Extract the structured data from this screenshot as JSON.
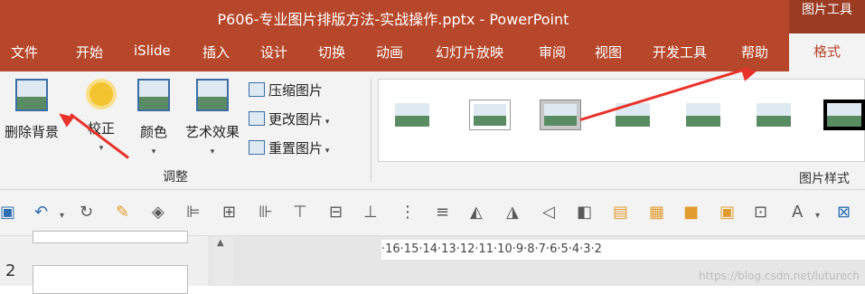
{
  "window": {
    "title": "P606-专业图片排版方法-实战操作.pptx  -  PowerPoint",
    "context_tab_title": "图片工具"
  },
  "tabs": [
    "文件",
    "开始",
    "iSlide",
    "插入",
    "设计",
    "切换",
    "动画",
    "幻灯片放映",
    "审阅",
    "视图",
    "开发工具",
    "帮助"
  ],
  "active_tab": "格式",
  "ribbon": {
    "adjust": {
      "remove_bg": "删除背景",
      "corrections": "校正",
      "color": "颜色",
      "artistic": "艺术效果",
      "compress": "压缩图片",
      "change": "更改图片",
      "reset": "重置图片",
      "group_label": "调整"
    },
    "styles": {
      "group_label": "图片样式"
    }
  },
  "toolbar_icons": [
    "save-icon",
    "undo-icon",
    "redo-icon",
    "format-painter-icon",
    "eraser-icon",
    "align-left-icon",
    "align-center-icon",
    "align-right-icon",
    "align-top-icon",
    "align-middle-icon",
    "align-bottom-icon",
    "distribute-h-icon",
    "distribute-v-icon",
    "rotate-icon",
    "flip-icon",
    "triangle-left-icon",
    "triangle-right-icon",
    "group-icon",
    "ungroup-icon",
    "bring-front-icon",
    "send-back-icon",
    "select-icon",
    "text-icon",
    "fit-icon"
  ],
  "ruler_text": "·16·15·14·13·12·11·10·9·8·7·6·5·4·3·2",
  "slide_number": "2",
  "watermark": "https://blog.csdn.net/luturech",
  "colors": {
    "accent": "#b7472a",
    "arrow": "#e8322a"
  }
}
